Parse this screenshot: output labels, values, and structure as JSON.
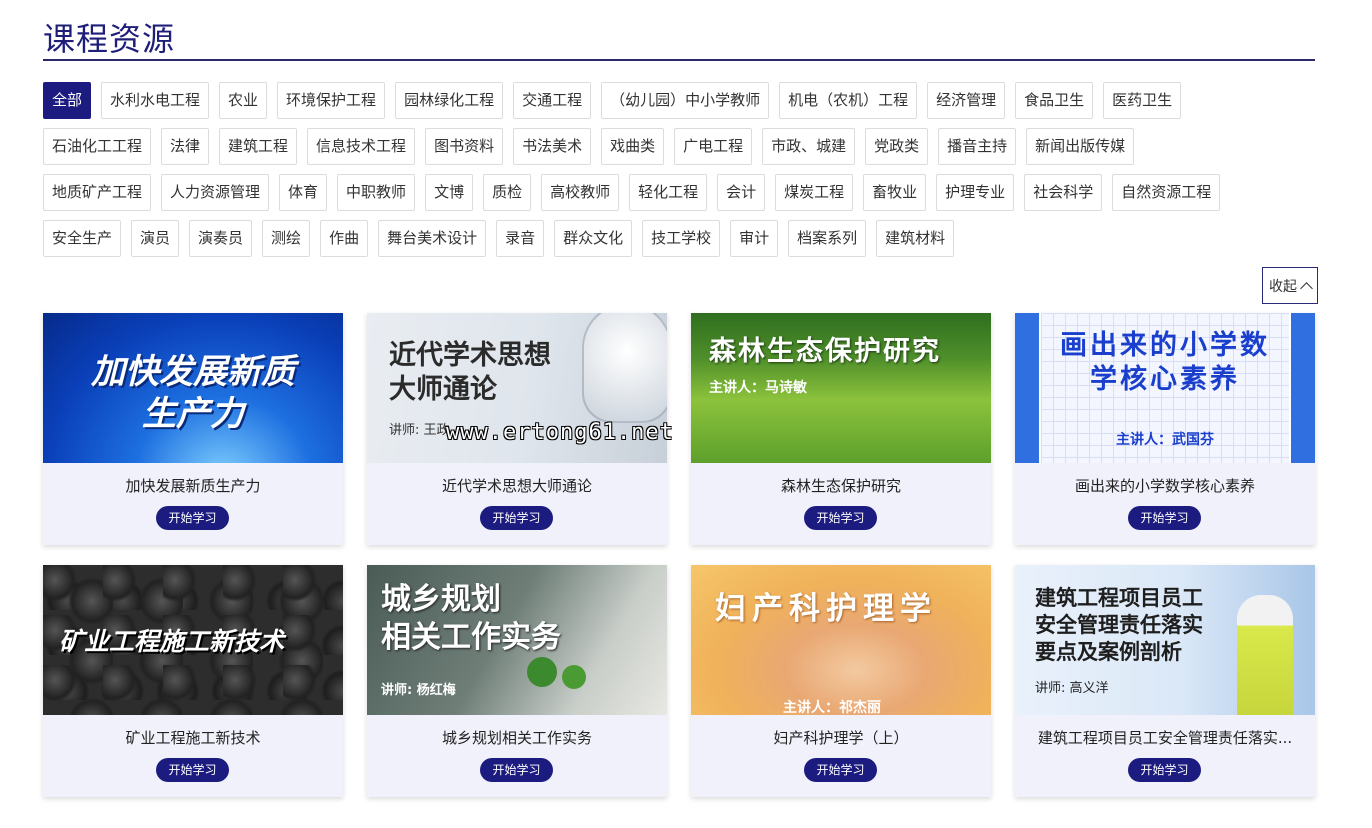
{
  "page": {
    "title": "课程资源"
  },
  "filters": {
    "rows": [
      [
        {
          "label": "全部",
          "active": true
        },
        {
          "label": "水利水电工程"
        },
        {
          "label": "农业"
        },
        {
          "label": "环境保护工程"
        },
        {
          "label": "园林绿化工程"
        },
        {
          "label": "交通工程"
        },
        {
          "label": "（幼儿园）中小学教师"
        },
        {
          "label": "机电（农机）工程"
        },
        {
          "label": "经济管理"
        },
        {
          "label": "食品卫生"
        },
        {
          "label": "医药卫生"
        }
      ],
      [
        {
          "label": "石油化工工程"
        },
        {
          "label": "法律"
        },
        {
          "label": "建筑工程"
        },
        {
          "label": "信息技术工程"
        },
        {
          "label": "图书资料"
        },
        {
          "label": "书法美术"
        },
        {
          "label": "戏曲类"
        },
        {
          "label": "广电工程"
        },
        {
          "label": "市政、城建"
        },
        {
          "label": "党政类"
        },
        {
          "label": "播音主持"
        },
        {
          "label": "新闻出版传媒"
        }
      ],
      [
        {
          "label": "地质矿产工程"
        },
        {
          "label": "人力资源管理"
        },
        {
          "label": "体育"
        },
        {
          "label": "中职教师"
        },
        {
          "label": "文博"
        },
        {
          "label": "质检"
        },
        {
          "label": "高校教师"
        },
        {
          "label": "轻化工程"
        },
        {
          "label": "会计"
        },
        {
          "label": "煤炭工程"
        },
        {
          "label": "畜牧业"
        },
        {
          "label": "护理专业"
        },
        {
          "label": "社会科学"
        },
        {
          "label": "自然资源工程"
        }
      ],
      [
        {
          "label": "安全生产"
        },
        {
          "label": "演员"
        },
        {
          "label": "演奏员"
        },
        {
          "label": "测绘"
        },
        {
          "label": "作曲"
        },
        {
          "label": "舞台美术设计"
        },
        {
          "label": "录音"
        },
        {
          "label": "群众文化"
        },
        {
          "label": "技工学校"
        },
        {
          "label": "审计"
        },
        {
          "label": "档案系列"
        },
        {
          "label": "建筑材料"
        }
      ]
    ],
    "collapse_label": "收起"
  },
  "courses": [
    {
      "title": "加快发展新质生产力",
      "thumb_title": "加快发展新质\n生产力",
      "thumb_sub": "",
      "button": "开始学习"
    },
    {
      "title": "近代学术思想大师通论",
      "thumb_title": "近代学术思想\n大师通论",
      "thumb_sub": "讲师: 王政",
      "button": "开始学习"
    },
    {
      "title": "森林生态保护研究",
      "thumb_title": "森林生态保护研究",
      "thumb_sub": "主讲人：马诗敏",
      "button": "开始学习"
    },
    {
      "title": "画出来的小学数学核心素养",
      "thumb_title": "画出来的小学数\n学核心素养",
      "thumb_sub": "主讲人：武国芬",
      "button": "开始学习"
    },
    {
      "title": "矿业工程施工新技术",
      "thumb_title": "矿业工程施工新技术",
      "thumb_sub": "",
      "button": "开始学习"
    },
    {
      "title": "城乡规划相关工作实务",
      "thumb_title": "城乡规划\n相关工作实务",
      "thumb_sub": "讲师: 杨红梅",
      "button": "开始学习"
    },
    {
      "title": "妇产科护理学（上）",
      "thumb_title": "妇产科护理学",
      "thumb_sub": "主讲人：祁杰丽",
      "button": "开始学习"
    },
    {
      "title": "建筑工程项目员工安全管理责任落实...",
      "thumb_title": "建筑工程项目员工\n安全管理责任落实\n要点及案例剖析",
      "thumb_sub": "讲师: 高义洋",
      "button": "开始学习"
    }
  ],
  "watermark": "www.ertong61.net"
}
